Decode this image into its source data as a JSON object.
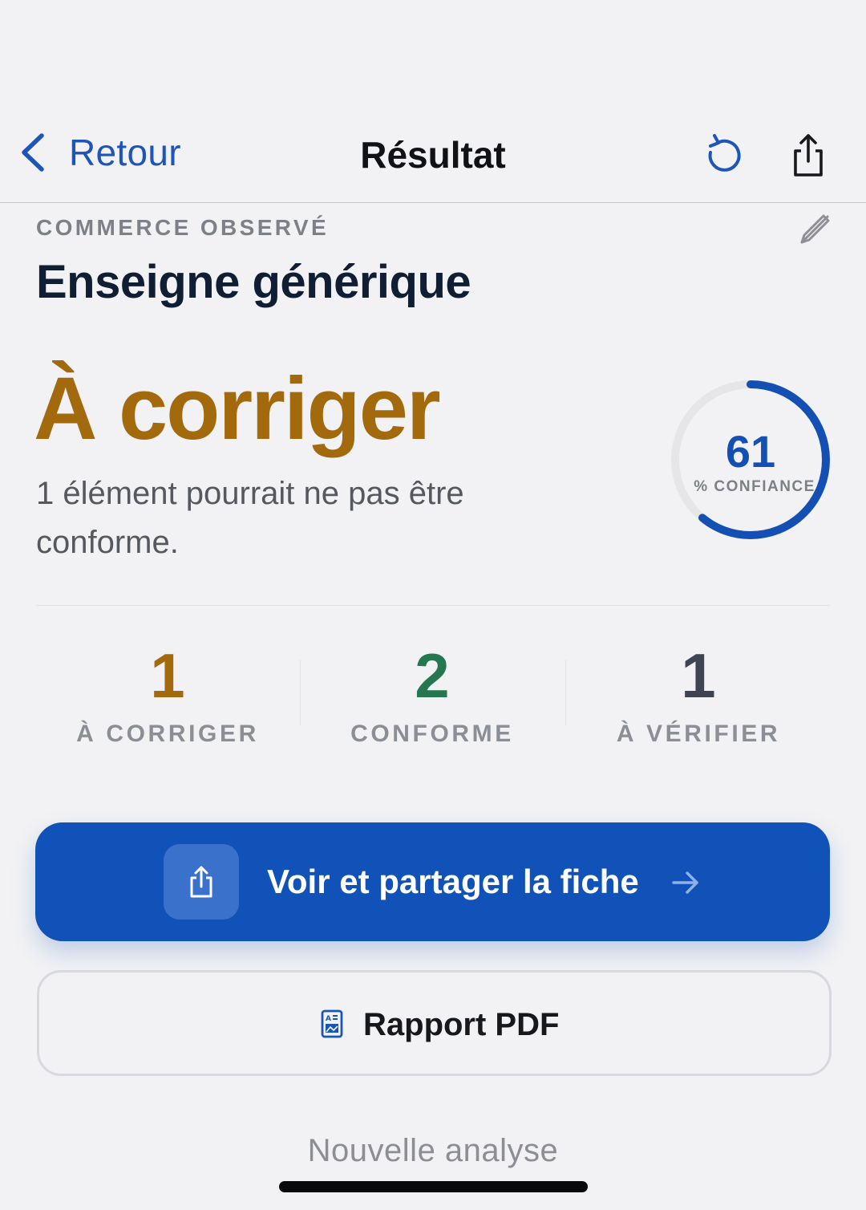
{
  "nav": {
    "back_label": "Retour",
    "title": "Résultat",
    "icons": [
      "chevron-left-icon",
      "refresh-icon",
      "share-icon"
    ]
  },
  "commerce": {
    "overline": "COMMERCE OBSERVÉ",
    "name": "Enseigne générique",
    "edit_icon": "pencil-icon"
  },
  "verdict": {
    "status": "À corriger",
    "description": "1 élément pourrait ne pas être conforme.",
    "status_color": "#a26a0c"
  },
  "confidence": {
    "value": "61",
    "label": "% CONFIANCE",
    "fraction": 0.61,
    "color": "#1450b4",
    "track_color": "#e6e6e8"
  },
  "stats": [
    {
      "value": "1",
      "label": "À CORRIGER",
      "color": "#a26a0c"
    },
    {
      "value": "2",
      "label": "CONFORME",
      "color": "#24774e"
    },
    {
      "value": "1",
      "label": "À VÉRIFIER",
      "color": "#3d4452"
    }
  ],
  "actions": {
    "primary_label": "Voir et partager la fiche",
    "primary_icon": "share-icon",
    "primary_color": "#1152b8",
    "secondary_label": "Rapport PDF",
    "secondary_icon": "document-icon",
    "tertiary_label": "Nouvelle analyse"
  }
}
